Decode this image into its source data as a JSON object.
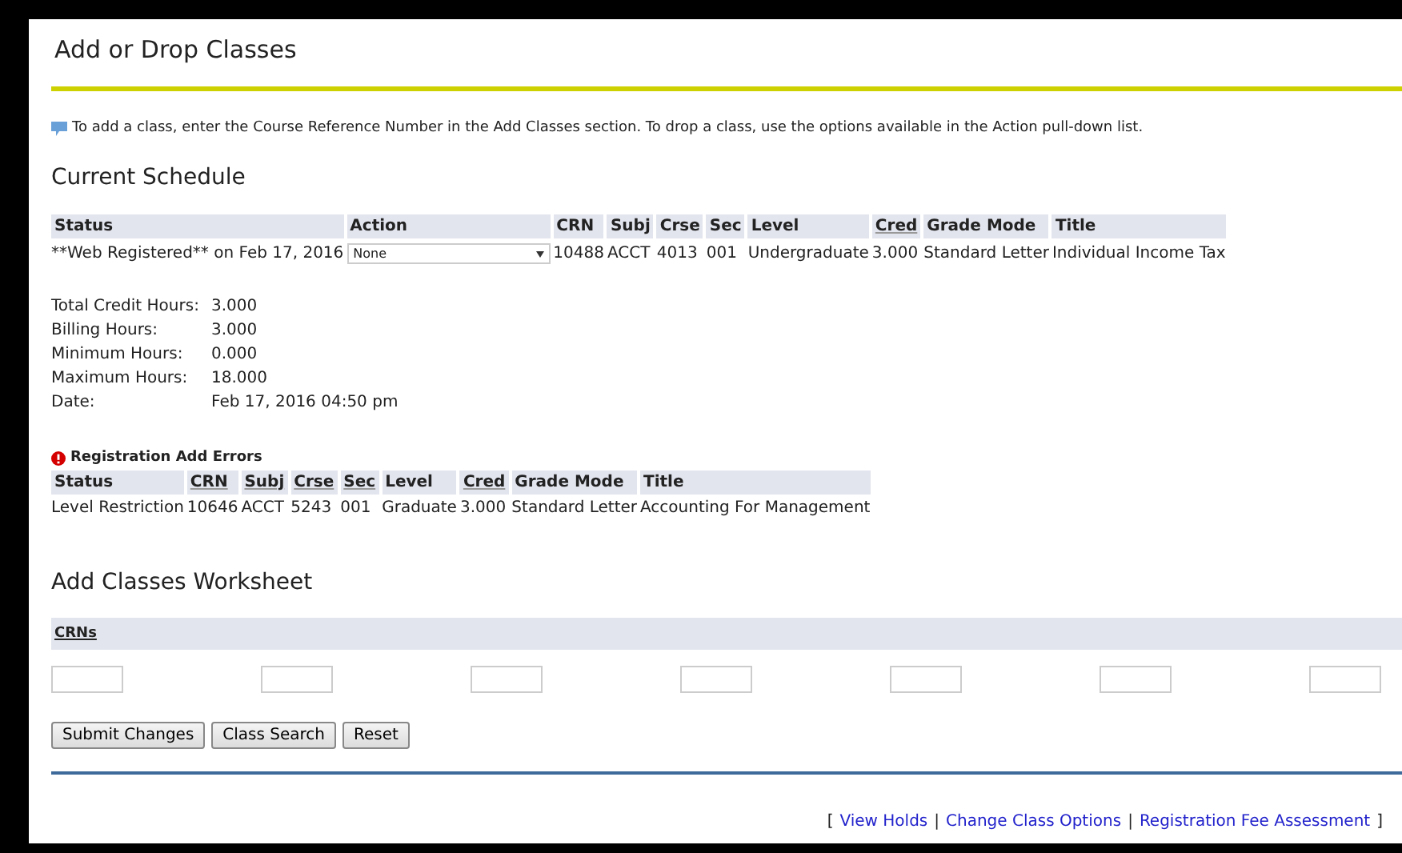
{
  "page_title": "Add or Drop Classes",
  "info": "To add a class, enter the Course Reference Number in the Add Classes section. To drop a class, use the options available in the Action pull-down list.",
  "schedule": {
    "heading": "Current Schedule",
    "columns": [
      {
        "label": "Status",
        "sortable": false
      },
      {
        "label": "Action",
        "sortable": false
      },
      {
        "label": "CRN",
        "sortable": false
      },
      {
        "label": "Subj",
        "sortable": false
      },
      {
        "label": "Crse",
        "sortable": false
      },
      {
        "label": "Sec",
        "sortable": false
      },
      {
        "label": "Level",
        "sortable": false
      },
      {
        "label": "Cred",
        "sortable": true
      },
      {
        "label": "Grade Mode",
        "sortable": false
      },
      {
        "label": "Title",
        "sortable": false
      }
    ],
    "rows": [
      {
        "status": "**Web Registered** on Feb 17, 2016",
        "action": "None",
        "crn": "10488",
        "subj": "ACCT",
        "crse": "4013",
        "sec": "001",
        "level": "Undergraduate",
        "cred": "3.000",
        "grade_mode": "Standard Letter",
        "title": "Individual Income Tax"
      }
    ]
  },
  "summary": [
    {
      "label": "Total Credit Hours:",
      "value": "3.000"
    },
    {
      "label": "Billing Hours:",
      "value": "3.000"
    },
    {
      "label": "Minimum Hours:",
      "value": "0.000"
    },
    {
      "label": "Maximum Hours:",
      "value": "18.000"
    },
    {
      "label": "Date:",
      "value": "Feb 17, 2016 04:50 pm"
    }
  ],
  "errors": {
    "heading": "Registration Add Errors",
    "columns": [
      {
        "label": "Status",
        "sortable": false
      },
      {
        "label": "CRN",
        "sortable": true
      },
      {
        "label": "Subj",
        "sortable": true
      },
      {
        "label": "Crse",
        "sortable": true
      },
      {
        "label": "Sec",
        "sortable": true
      },
      {
        "label": "Level",
        "sortable": false
      },
      {
        "label": "Cred",
        "sortable": true
      },
      {
        "label": "Grade Mode",
        "sortable": false
      },
      {
        "label": "Title",
        "sortable": false
      }
    ],
    "rows": [
      {
        "status": "Level Restriction",
        "crn": "10646",
        "subj": "ACCT",
        "crse": "5243",
        "sec": "001",
        "level": "Graduate",
        "cred": "3.000",
        "grade_mode": "Standard Letter",
        "title": "Accounting For Management"
      }
    ]
  },
  "worksheet": {
    "heading": "Add Classes Worksheet",
    "crns_label": "CRNs",
    "crn_fields": [
      {
        "kind": "text"
      },
      {
        "kind": "text"
      },
      {
        "kind": "text"
      },
      {
        "kind": "text"
      },
      {
        "kind": "text"
      },
      {
        "kind": "text"
      },
      {
        "kind": "text"
      }
    ]
  },
  "buttons": [
    "Submit Changes",
    "Class Search",
    "Reset"
  ],
  "footer_links": [
    "View Holds",
    "Change Class Options",
    "Registration Fee Assessment"
  ],
  "footer_brackets": [
    "[",
    "]"
  ],
  "footer_separator": "|"
}
